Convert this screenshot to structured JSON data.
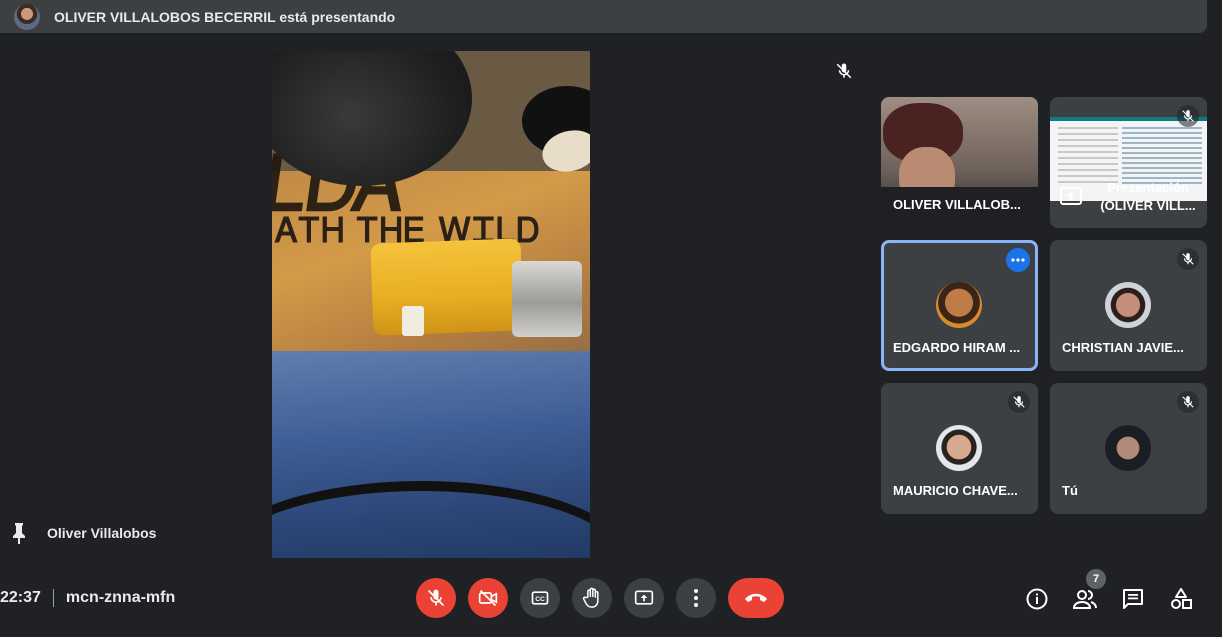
{
  "header": {
    "presenter_text": "OLIVER VILLALOBOS BECERRIL está presentando"
  },
  "pinned": {
    "label": "Oliver Villalobos"
  },
  "participants": [
    {
      "name": "OLIVER VILLALOB...",
      "type": "video",
      "mic_muted": false
    },
    {
      "name": "Presentación (OLIVER VILL...",
      "type": "presentation",
      "mic_muted": true
    },
    {
      "name": "EDGARDO HIRAM ...",
      "type": "avatar",
      "mic_muted": false,
      "active": true
    },
    {
      "name": "CHRISTIAN JAVIE...",
      "type": "avatar",
      "mic_muted": true
    },
    {
      "name": "MAURICIO CHAVE...",
      "type": "avatar",
      "mic_muted": true
    },
    {
      "name": "Tú",
      "type": "avatar",
      "mic_muted": true
    }
  ],
  "presentation_label": {
    "line1": "Presentación",
    "line2": "(OLIVER VILL..."
  },
  "meeting": {
    "time": "22:37",
    "code": "mcn-znna-mfn"
  },
  "people_count": "7",
  "colors": {
    "background": "#202124",
    "tile": "#3c4043",
    "danger": "#ea4335",
    "accent": "#8ab4f8",
    "more_button": "#1a73e8"
  },
  "icons": {
    "controls": [
      "mic-off-icon",
      "camera-off-icon",
      "captions-icon",
      "raise-hand-icon",
      "present-icon",
      "more-options-icon",
      "end-call-icon"
    ],
    "right": [
      "info-icon",
      "people-icon",
      "chat-icon",
      "activities-icon"
    ]
  }
}
